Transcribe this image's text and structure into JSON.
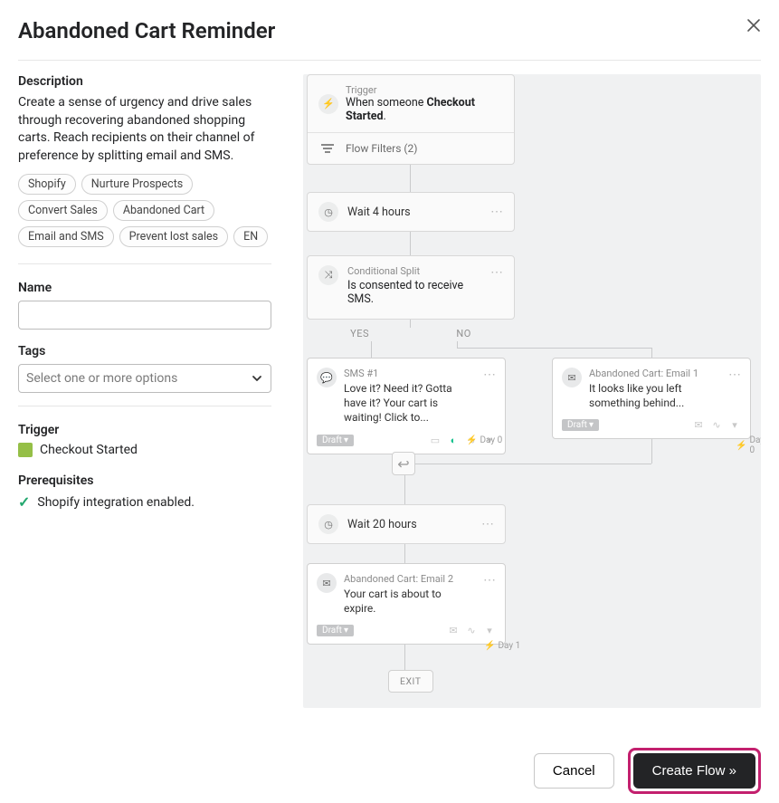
{
  "header": {
    "title": "Abandoned Cart Reminder"
  },
  "description": {
    "label": "Description",
    "text": "Create a sense of urgency and drive sales through recovering abandoned shopping carts. Reach recipients on their channel of preference by splitting email and SMS.",
    "tags": [
      "Shopify",
      "Nurture Prospects",
      "Convert Sales",
      "Abandoned Cart",
      "Email and SMS",
      "Prevent lost sales",
      "EN"
    ]
  },
  "name": {
    "label": "Name",
    "value": ""
  },
  "tags_select": {
    "label": "Tags",
    "placeholder": "Select one or more options"
  },
  "trigger_section": {
    "label": "Trigger",
    "value": "Checkout Started"
  },
  "prereq": {
    "label": "Prerequisites",
    "value": "Shopify integration enabled."
  },
  "flow": {
    "trigger": {
      "label": "Trigger",
      "prefix": "When someone ",
      "event": "Checkout Started",
      "suffix": ".",
      "filters": "Flow Filters (2)"
    },
    "wait1": "Wait 4 hours",
    "split": {
      "label": "Conditional Split",
      "text": "Is consented to receive SMS."
    },
    "yes": "YES",
    "no": "NO",
    "sms": {
      "title": "SMS #1",
      "body": "Love it? Need it? Gotta have it? Your cart is waiting! Click to...",
      "status": "Draft"
    },
    "email1": {
      "title": "Abandoned Cart: Email 1",
      "body": "It looks like you left something behind...",
      "status": "Draft"
    },
    "day0": "Day 0",
    "wait2": "Wait 20 hours",
    "email2": {
      "title": "Abandoned Cart: Email 2",
      "body": "Your cart is about to expire.",
      "status": "Draft"
    },
    "day1": "Day 1",
    "exit": "EXIT"
  },
  "footer": {
    "cancel": "Cancel",
    "create": "Create Flow »"
  }
}
